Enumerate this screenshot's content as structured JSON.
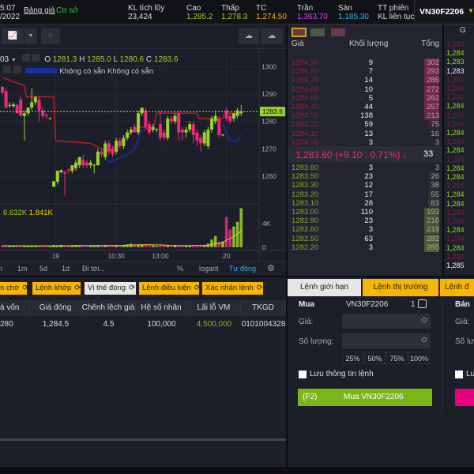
{
  "topbar": {
    "time": "5:07",
    "date": "/2022",
    "board_link": "Bảng giá",
    "market": "Cơ sở",
    "stats": [
      {
        "label": "KL tích lũy",
        "value": "23,424",
        "color": "#dddddd"
      },
      {
        "label": "Cao",
        "value": "1,285.2",
        "color": "#9bd22a"
      },
      {
        "label": "Thấp",
        "value": "1,278.3",
        "color": "#9bd22a"
      },
      {
        "label": "TC",
        "value": "1,274.50",
        "color": "#f7b500"
      },
      {
        "label": "Trần",
        "value": "1,363.70",
        "color": "#e040fb"
      },
      {
        "label": "Sàn",
        "value": "1,185.30",
        "color": "#29b6f6"
      },
      {
        "label": "TT phiên",
        "value": "KL liên tục",
        "color": "#dddddd"
      }
    ],
    "symbol": "VN30F2206"
  },
  "chart": {
    "symbol_suffix": "03",
    "ohlc": {
      "o": "O",
      "o_v": "1281.3",
      "h": "H",
      "h_v": "1285.0",
      "l": "L",
      "l_v": "1280.6",
      "c": "C",
      "c_v": "1283.6"
    },
    "indicator_text": "Không có sẵn  Không có sẵn",
    "volume_text": [
      "6.632K",
      "1.841K"
    ],
    "price_ticks": [
      1300,
      1290,
      1280,
      1270,
      1260
    ],
    "last_price": "1283.6",
    "volume_ticks": [
      {
        "v": 4,
        "label": "4K"
      },
      {
        "v": 0,
        "label": "0"
      }
    ],
    "time_labels": [
      {
        "i": 14.5,
        "label": "19"
      },
      {
        "i": 31,
        "label": "10:30"
      },
      {
        "i": 43,
        "label": "13:00"
      },
      {
        "i": 61,
        "label": "20"
      }
    ],
    "bottom_toolbar": [
      "n",
      "1m",
      "5d",
      "1d",
      "Đi tới...",
      "%",
      "logarit",
      "Tự động"
    ],
    "up_color": "#9bd22a",
    "down_color": "#f0287a",
    "candles": [
      [
        1292.6,
        1293,
        1290,
        1290.6
      ],
      [
        1291,
        1292,
        1285,
        1285
      ],
      [
        1286,
        1287,
        1285,
        1286
      ],
      [
        1285.6,
        1287,
        1285,
        1286.2
      ],
      [
        1286,
        1286.5,
        1283,
        1283
      ],
      [
        1288,
        1289,
        1282,
        1282
      ],
      [
        1282,
        1284,
        1273,
        1283
      ],
      [
        1283,
        1285,
        1282,
        1285
      ],
      [
        1285,
        1292,
        1284,
        1287
      ],
      [
        1287,
        1289,
        1286,
        1289
      ],
      [
        1288,
        1289,
        1280,
        1284
      ],
      [
        1284,
        1285,
        1281,
        1282
      ],
      [
        1282.4,
        1283,
        1281,
        1282
      ],
      [
        1281,
        1281.4,
        1280.6,
        1281.2
      ],
      [
        1256.2,
        1258,
        1256,
        1258.2
      ],
      [
        1258,
        1262,
        1257,
        1262
      ],
      [
        1261.5,
        1262.5,
        1261,
        1262.2
      ],
      [
        1261.5,
        1262,
        1253,
        1261
      ],
      [
        1262.4,
        1263,
        1261,
        1262
      ],
      [
        1262,
        1264,
        1261,
        1264
      ],
      [
        1263,
        1266,
        1262,
        1265
      ],
      [
        1264,
        1267,
        1263,
        1267
      ],
      [
        1266,
        1268,
        1263,
        1264
      ],
      [
        1265,
        1266,
        1263,
        1264
      ],
      [
        1264,
        1266,
        1263,
        1265
      ],
      [
        1264,
        1264.4,
        1261,
        1264.2
      ],
      [
        1264,
        1270,
        1264,
        1269
      ],
      [
        1269,
        1270,
        1267,
        1268
      ],
      [
        1267,
        1273,
        1266,
        1272
      ],
      [
        1272,
        1273,
        1268,
        1269
      ],
      [
        1270,
        1271,
        1267,
        1268
      ],
      [
        1269,
        1274,
        1268,
        1273
      ],
      [
        1273,
        1274,
        1270,
        1271
      ],
      [
        1271,
        1275,
        1270,
        1274
      ],
      [
        1274,
        1277,
        1273,
        1276
      ],
      [
        1276,
        1278,
        1275,
        1277
      ],
      [
        1278,
        1279,
        1276,
        1276
      ],
      [
        1276,
        1284,
        1275,
        1283
      ],
      [
        1283,
        1285,
        1282,
        1285
      ],
      [
        1284,
        1285,
        1277,
        1278
      ],
      [
        1279,
        1280,
        1275,
        1276
      ],
      [
        1277,
        1279,
        1276,
        1278
      ],
      [
        1277,
        1277.4,
        1276,
        1277.2
      ],
      [
        1279,
        1284,
        1273,
        1274
      ],
      [
        1276,
        1277,
        1273,
        1274
      ],
      [
        1274,
        1282,
        1273,
        1281
      ],
      [
        1281,
        1282,
        1279,
        1280
      ],
      [
        1280,
        1283,
        1279,
        1282
      ],
      [
        1283,
        1284,
        1273,
        1276
      ],
      [
        1277,
        1278,
        1273,
        1276
      ],
      [
        1276,
        1278,
        1274,
        1277
      ],
      [
        1277,
        1280,
        1276,
        1279
      ],
      [
        1279,
        1280,
        1272,
        1275
      ],
      [
        1276,
        1277,
        1271,
        1273
      ],
      [
        1274,
        1275,
        1269,
        1272
      ],
      [
        1272,
        1277,
        1271,
        1276
      ],
      [
        1271,
        1278,
        1270,
        1277
      ],
      [
        1277,
        1282,
        1276,
        1281
      ],
      [
        1280,
        1284,
        1279,
        1282
      ],
      [
        1281,
        1282,
        1274,
        1275
      ],
      [
        1275,
        1275.4,
        1274.6,
        1275.2
      ],
      [
        1284,
        1285,
        1280,
        1281
      ],
      [
        1282,
        1283,
        1279,
        1280
      ],
      [
        1281,
        1283,
        1280,
        1283
      ],
      [
        1282,
        1285,
        1281,
        1284
      ],
      [
        1283,
        1286,
        1282,
        1283.6
      ]
    ],
    "volumes_k": [
      0.3,
      0.2,
      0.3,
      0.2,
      0.3,
      0.2,
      0.3,
      0.2,
      0.3,
      0.2,
      0.2,
      0.3,
      0.2,
      0.2,
      0.4,
      0.3,
      0.4,
      0.3,
      0.2,
      0.3,
      0.4,
      0.3,
      0.3,
      0.2,
      0.3,
      0.3,
      0.4,
      0.3,
      0.4,
      0.3,
      0.3,
      0.4,
      0.3,
      0.4,
      0.5,
      0.6,
      0.5,
      0.4,
      0.5,
      0.4,
      0.3,
      0.3,
      0.2,
      0.3,
      0.3,
      0.3,
      0.2,
      0.4,
      0.3,
      0.3,
      0.3,
      0.3,
      0.4,
      0.3,
      0.4,
      0.3,
      0.6,
      1.3,
      1.9,
      0.9,
      1.0,
      5.1,
      3.0,
      3.5,
      4.3,
      6.6
    ],
    "upper_line": [
      [
        0,
        1296
      ],
      [
        6,
        1293
      ],
      [
        6.5,
        1289
      ],
      [
        14,
        1289
      ],
      [
        14.5,
        1273
      ],
      [
        24,
        1272
      ],
      [
        27,
        1270
      ],
      [
        29,
        1269
      ],
      [
        36,
        1277
      ],
      [
        38,
        1278
      ],
      [
        41,
        1277
      ],
      [
        42,
        1283
      ],
      [
        53,
        1283
      ],
      [
        53.5,
        1281
      ],
      [
        60,
        1281
      ],
      [
        60.5,
        1283
      ],
      [
        65,
        1283
      ]
    ],
    "lower_line": [
      [
        28,
        1267
      ],
      [
        29,
        1265
      ],
      [
        34,
        1268
      ],
      [
        36,
        1270
      ],
      [
        38,
        1277
      ],
      [
        42,
        1277
      ]
    ],
    "lower_line2": [
      [
        60,
        1279
      ],
      [
        62,
        1273
      ],
      [
        64,
        1273
      ],
      [
        65,
        1275
      ]
    ]
  },
  "orderbook": {
    "headers": {
      "price": "Giá",
      "volume": "Khối lượng",
      "total": "Tổng"
    },
    "asks": [
      [
        "1284.90",
        "9",
        "302"
      ],
      [
        "1284.80",
        "7",
        "293"
      ],
      [
        "1284.70",
        "14",
        "286"
      ],
      [
        "1284.60",
        "10",
        "272"
      ],
      [
        "1284.50",
        "5",
        "262"
      ],
      [
        "1284.40",
        "44",
        "257"
      ],
      [
        "1284.30",
        "138",
        "213"
      ],
      [
        "1284.20",
        "59",
        "75"
      ],
      [
        "1284.10",
        "13",
        "16"
      ],
      [
        "1284.00",
        "3",
        "3"
      ]
    ],
    "last": {
      "price": "1,283.60",
      "change": "(+9.10 : 0.71%)",
      "arrow": "↓",
      "volume": "33"
    },
    "bids": [
      [
        "1283.60",
        "3",
        "3"
      ],
      [
        "1283.50",
        "23",
        "26"
      ],
      [
        "1283.30",
        "12",
        "38"
      ],
      [
        "1283.20",
        "17",
        "55"
      ],
      [
        "1283.10",
        "28",
        "83"
      ],
      [
        "1283.00",
        "110",
        "193"
      ],
      [
        "1282.80",
        "23",
        "216"
      ],
      [
        "1282.60",
        "3",
        "219"
      ],
      [
        "1282.50",
        "63",
        "282"
      ],
      [
        "1282.20",
        "3",
        "285"
      ]
    ]
  },
  "trades": {
    "header": "G",
    "rows": [
      [
        "1,284",
        "d"
      ],
      [
        "1,284",
        "u"
      ],
      [
        "1,283",
        "u"
      ],
      [
        "1,283",
        "n"
      ],
      [
        "1,284",
        "d"
      ],
      [
        "1,284",
        "d"
      ],
      [
        "1,284",
        "d"
      ],
      [
        "1,284",
        "u"
      ],
      [
        "1,284",
        "d"
      ],
      [
        "1,284",
        "d"
      ],
      [
        "1,284",
        "u"
      ],
      [
        "1,284",
        "d"
      ],
      [
        "1,284",
        "u"
      ],
      [
        "1,284",
        "d"
      ],
      [
        "1,284",
        "u"
      ],
      [
        "1,284",
        "u"
      ],
      [
        "1,284",
        "d"
      ],
      [
        "1,284",
        "u"
      ],
      [
        "1,284",
        "u"
      ],
      [
        "1,284",
        "d"
      ],
      [
        "1,284",
        "d"
      ],
      [
        "1,284",
        "u"
      ],
      [
        "1,284",
        "d"
      ],
      [
        "1,284",
        "u"
      ],
      [
        "1,284",
        "d"
      ],
      [
        "1,285",
        "n"
      ]
    ]
  },
  "positions": {
    "tabs": [
      "n chờ",
      "Lệnh khớp",
      "Vị thế đóng",
      "Lệnh điều kiện",
      "Xác nhận lệnh"
    ],
    "columns": [
      "á vốn",
      "Giá đóng",
      "Chênh lệch giá",
      "Hệ số nhân",
      "Lãi lỗ VM",
      "TKGD"
    ],
    "row": [
      "280",
      "1,284.5",
      "4.5",
      "100,000",
      "4,500,000",
      "0101004328"
    ]
  },
  "order": {
    "tabs": [
      "Lệnh giới hạn",
      "Lệnh thị trường",
      "Lệnh đ"
    ],
    "buy_label": "Mua",
    "symbol": "VN30F2206",
    "qty": "1",
    "price_label": "Giá:",
    "qty_label": "Số lượng:",
    "percents": [
      "25%",
      "50%",
      "75%",
      "100%"
    ],
    "save_label": "Lưu thông tin lệnh",
    "buy_key": "(F2)",
    "buy_button": "Mua VN30F2206",
    "sell_label": "Bán",
    "sell_price_label": "Giá:",
    "sell_qty_label": "Số lượ",
    "sell_save": "Lư",
    "buy_color": "#7cb518",
    "sell_color": "#e6007e"
  }
}
